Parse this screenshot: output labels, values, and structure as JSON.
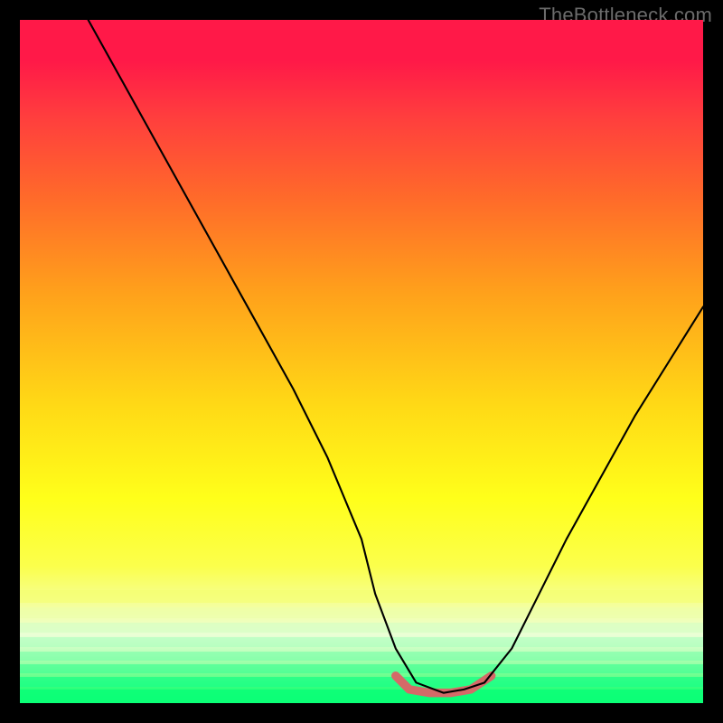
{
  "watermark": "TheBottleneck.com",
  "chart_data": {
    "type": "line",
    "title": "",
    "xlabel": "",
    "ylabel": "",
    "xlim": [
      0,
      100
    ],
    "ylim": [
      0,
      100
    ],
    "grid": false,
    "legend": false,
    "gradient_stops": [
      {
        "pct": 0,
        "color": "#ff1948"
      },
      {
        "pct": 6,
        "color": "#ff1948"
      },
      {
        "pct": 14,
        "color": "#ff3d3e"
      },
      {
        "pct": 26,
        "color": "#ff6a2a"
      },
      {
        "pct": 40,
        "color": "#ffa11b"
      },
      {
        "pct": 56,
        "color": "#ffd816"
      },
      {
        "pct": 70,
        "color": "#ffff1a"
      },
      {
        "pct": 80,
        "color": "#fbff4c"
      },
      {
        "pct": 86,
        "color": "#eaffd6"
      },
      {
        "pct": 93,
        "color": "#b8ffb8"
      },
      {
        "pct": 100,
        "color": "#0bff6a"
      }
    ],
    "series": [
      {
        "name": "curve",
        "color": "#000000",
        "stroke_width": 2,
        "x": [
          10,
          15,
          20,
          25,
          30,
          35,
          40,
          45,
          50,
          52,
          55,
          58,
          62,
          65,
          68,
          72,
          76,
          80,
          85,
          90,
          95,
          100
        ],
        "y": [
          100,
          91,
          82,
          73,
          64,
          55,
          46,
          36,
          24,
          16,
          8,
          3,
          1.5,
          2,
          3,
          8,
          16,
          24,
          33,
          42,
          50,
          58
        ]
      },
      {
        "name": "flat-highlight",
        "color": "#d46a68",
        "stroke_width": 9,
        "x": [
          55,
          57,
          60,
          63,
          66,
          69
        ],
        "y": [
          4,
          2,
          1.5,
          1.5,
          2,
          4
        ]
      }
    ],
    "optimal_region": {
      "x_start": 55,
      "x_end": 69,
      "y_floor": 1.5
    }
  }
}
